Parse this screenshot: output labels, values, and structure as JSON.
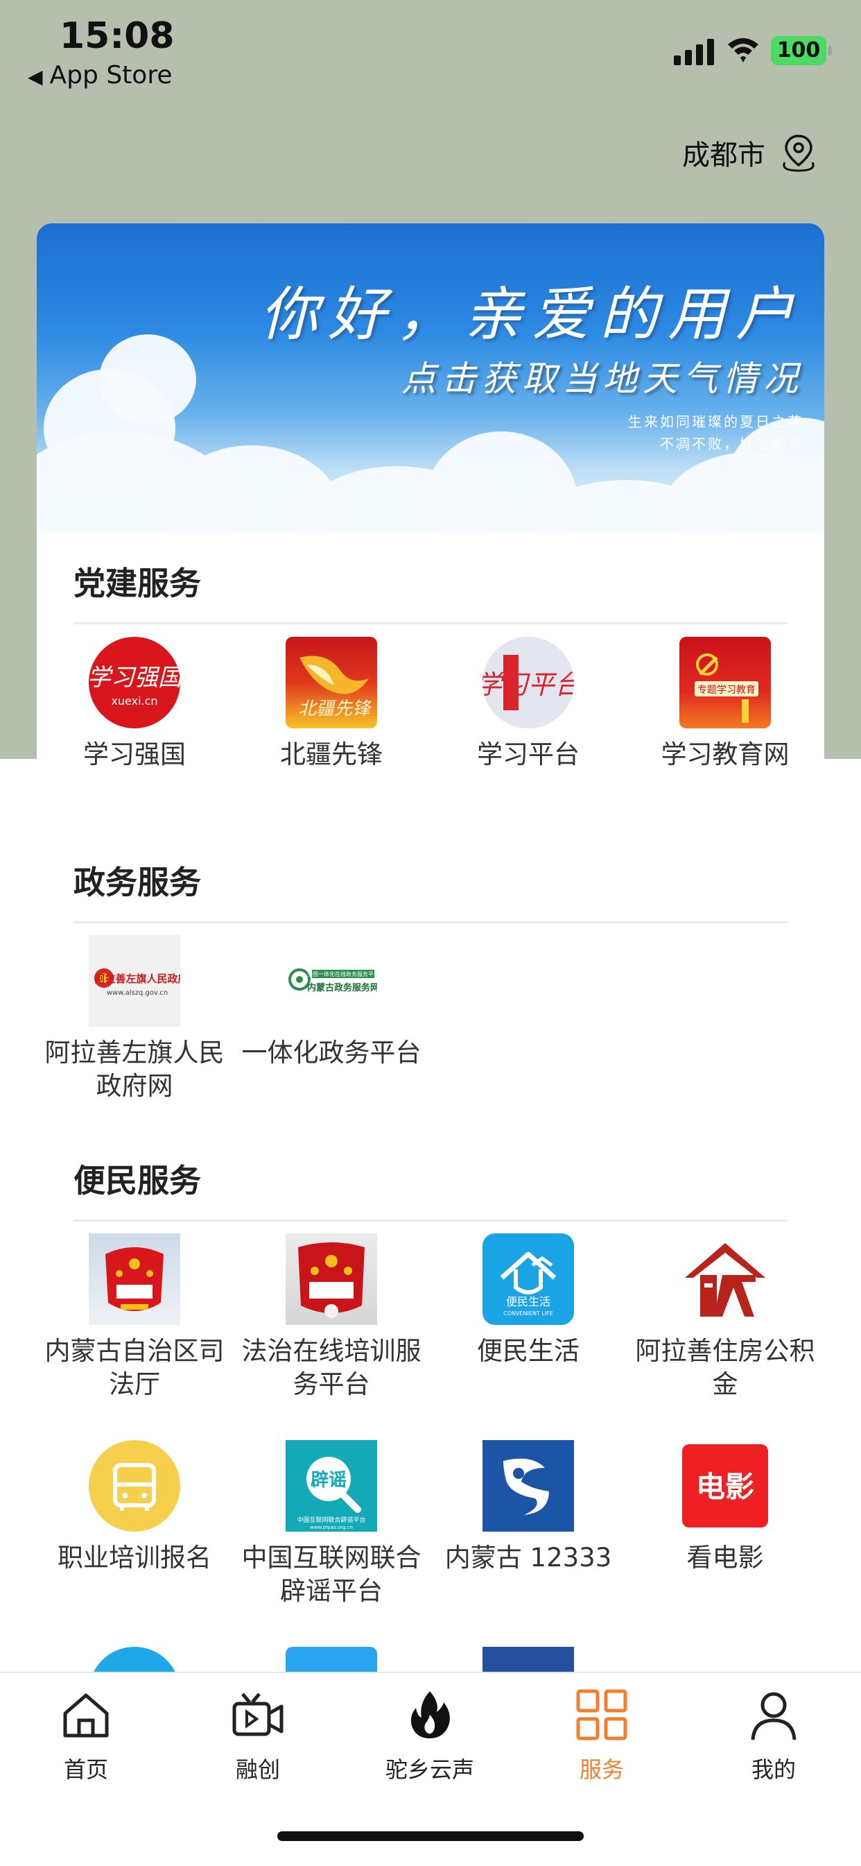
{
  "status_bar": {
    "time": "15:08",
    "back_label": "App Store",
    "battery": "100"
  },
  "location": {
    "city": "成都市"
  },
  "banner": {
    "title": "你好，亲爱的用户",
    "subtitle": "点击获取当地天气情况",
    "poem_line1": "生来如同璀璨的夏日之花",
    "poem_line2": "不凋不败，妖冶如火"
  },
  "sections": [
    {
      "title": "党建服务",
      "items": [
        {
          "label": "学习强国",
          "icon": "xuexi-qiangguo-icon"
        },
        {
          "label": "北疆先锋",
          "icon": "beijiang-xianfeng-icon"
        },
        {
          "label": "学习平台",
          "icon": "xuexi-pingtai-icon"
        },
        {
          "label": "学习教育网",
          "icon": "xuexi-jiaoyu-icon"
        }
      ]
    },
    {
      "title": "政务服务",
      "items": [
        {
          "label": "阿拉善左旗人民政府网",
          "icon": "alashan-gov-icon",
          "badge": "阿拉善左旗人民政府",
          "badge_url": "www.alszq.gov.cn"
        },
        {
          "label": "一体化政务平台",
          "icon": "neimenggu-gov-icon",
          "badge_top": "全国一体化在线政务服务平台",
          "badge": "内蒙古政务服务网"
        }
      ]
    },
    {
      "title": "便民服务",
      "items": [
        {
          "label": "内蒙古自治区司法厅",
          "icon": "justice-emblem-icon"
        },
        {
          "label": "法治在线培训服务平台",
          "icon": "law-training-icon"
        },
        {
          "label": "便民生活",
          "icon": "convenient-life-icon",
          "badge": "便民生活",
          "badge_en": "CONVENIENT LIFE"
        },
        {
          "label": "阿拉善住房公积金",
          "icon": "housing-fund-icon"
        },
        {
          "label": "职业培训报名",
          "icon": "bus-icon"
        },
        {
          "label": "中国互联网联合辟谣平台",
          "icon": "rumor-refute-icon",
          "badge": "辟谣",
          "badge_bottom": "中国互联网联合辟谣平台",
          "badge_url": "www.piyao.org.cn"
        },
        {
          "label": "内蒙古 12333",
          "icon": "nmg-12333-icon"
        },
        {
          "label": "看电影",
          "icon": "movie-icon",
          "badge": "电影"
        }
      ]
    }
  ],
  "tabbar": {
    "tabs": [
      {
        "label": "首页",
        "icon": "home-icon"
      },
      {
        "label": "融创",
        "icon": "video-icon"
      },
      {
        "label": "驼乡云声",
        "icon": "flame-icon"
      },
      {
        "label": "服务",
        "icon": "grid-icon",
        "active": true
      },
      {
        "label": "我的",
        "icon": "user-icon"
      }
    ]
  },
  "colors": {
    "accent": "#f27f2d",
    "header_bg": "#b6bead"
  }
}
